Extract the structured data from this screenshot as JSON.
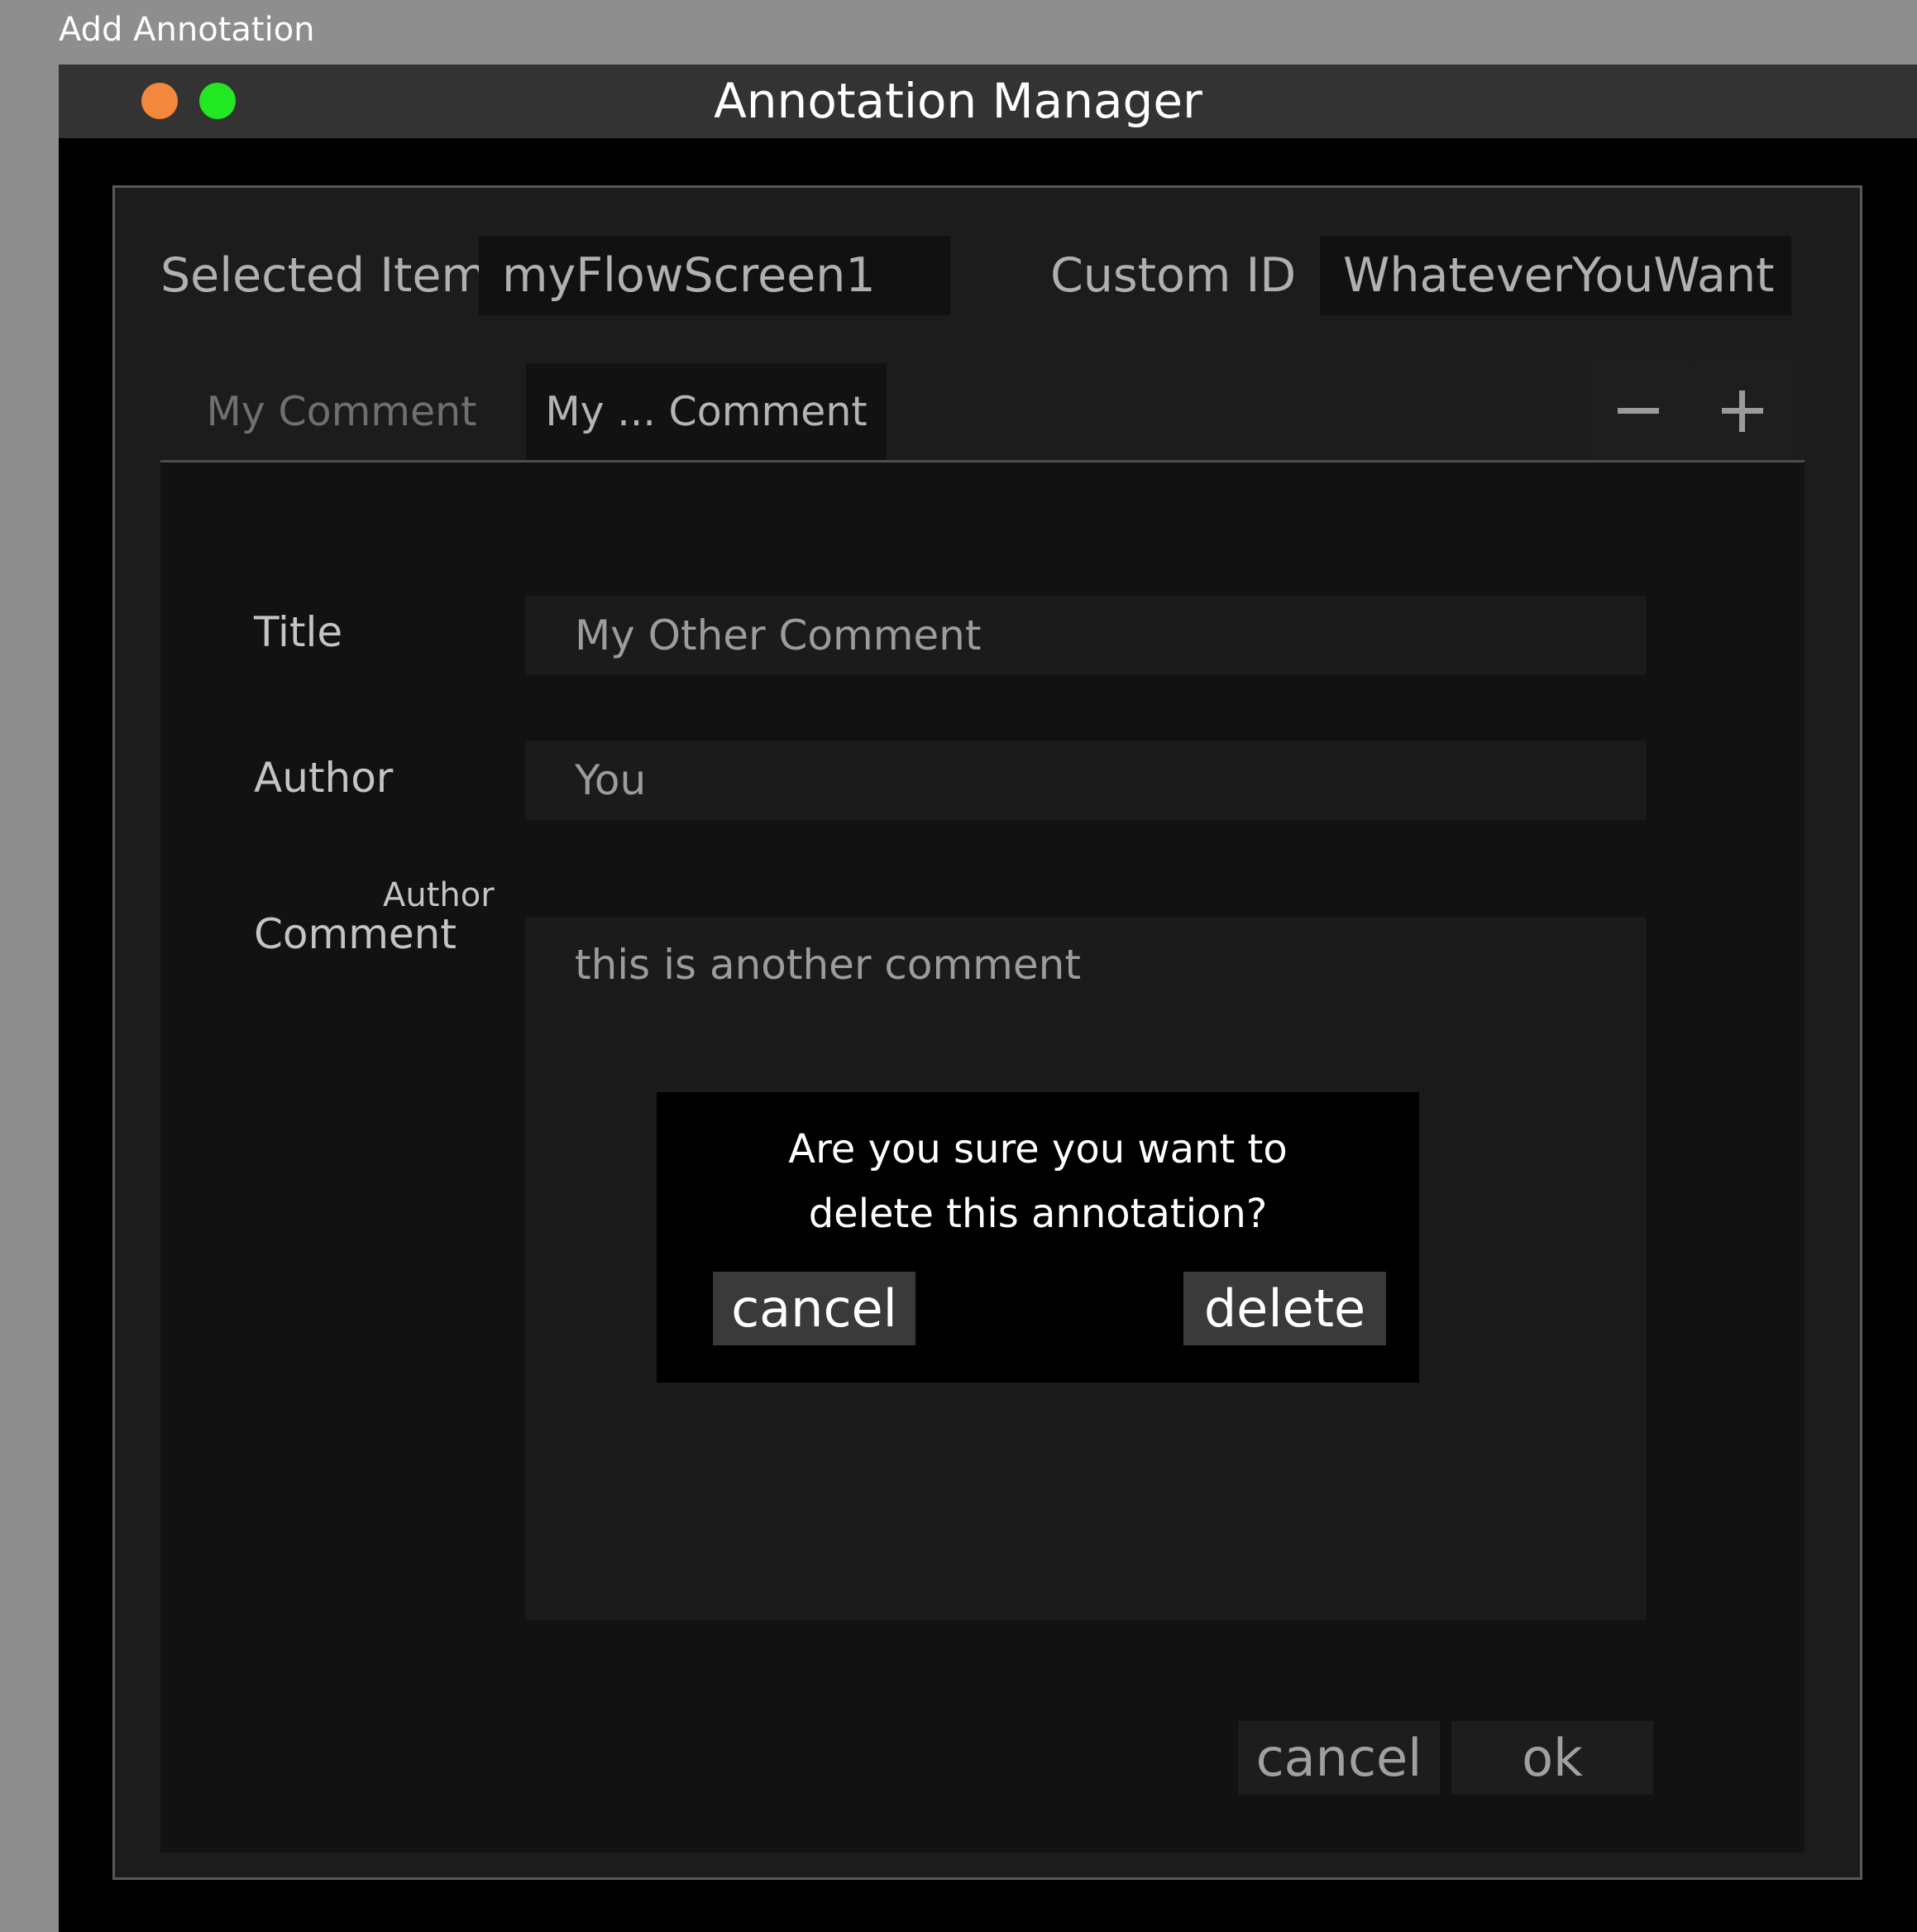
{
  "page": {
    "label": "Add Annotation"
  },
  "window": {
    "title": "Annotation Manager",
    "controls": [
      {
        "name": "close",
        "color": "#f4873b"
      },
      {
        "name": "zoom",
        "color": "#22e822"
      }
    ]
  },
  "header": {
    "selected_item_label": "Selected Item",
    "selected_item_value": "myFlowScreen1",
    "custom_id_label": "Custom ID",
    "custom_id_value": "WhateverYouWant"
  },
  "tabs": [
    {
      "label": "My Comment",
      "active": false
    },
    {
      "label": "My ... Comment",
      "active": true
    }
  ],
  "toolbar": {
    "remove_icon": "minus-icon",
    "add_icon": "plus-icon"
  },
  "form": {
    "title_label": "Title",
    "title_value": "My  Other Comment",
    "author_label": "Author",
    "author_value": "You",
    "comment_small_label": "Author",
    "comment_label": "Comment",
    "comment_value": "this is another comment"
  },
  "confirm_dialog": {
    "message_line1": "Are you sure you want to",
    "message_line2": "delete this annotation?",
    "cancel_label": "cancel",
    "delete_label": "delete"
  },
  "footer": {
    "cancel_label": "cancel",
    "ok_label": "ok"
  }
}
